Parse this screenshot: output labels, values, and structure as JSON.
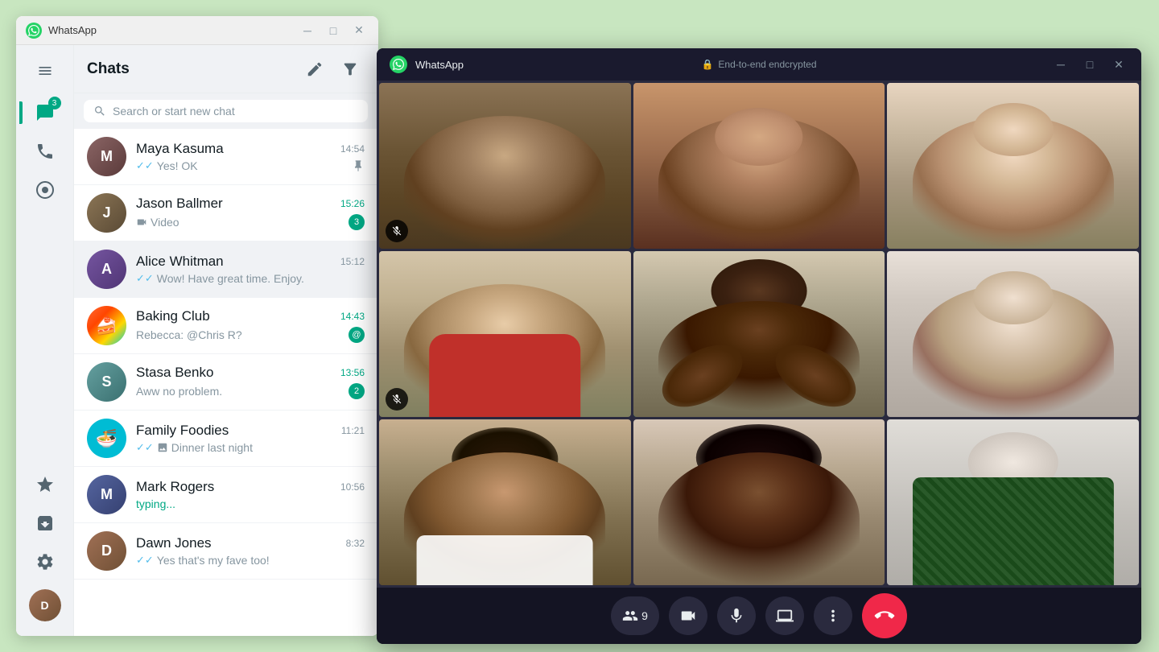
{
  "app": {
    "name": "WhatsApp",
    "titlebar": {
      "title": "WhatsApp"
    }
  },
  "sidebar": {
    "badge": "3",
    "items": [
      {
        "id": "chats",
        "label": "Chats",
        "icon": "chat",
        "active": true
      },
      {
        "id": "calls",
        "label": "Calls",
        "icon": "phone"
      },
      {
        "id": "status",
        "label": "Status",
        "icon": "status"
      },
      {
        "id": "starred",
        "label": "Starred",
        "icon": "star"
      },
      {
        "id": "archive",
        "label": "Archive",
        "icon": "archive"
      },
      {
        "id": "settings",
        "label": "Settings",
        "icon": "settings"
      }
    ]
  },
  "chat_panel": {
    "title": "Chats",
    "search_placeholder": "Search or start new chat",
    "chats": [
      {
        "id": "maya",
        "name": "Maya Kasuma",
        "preview": "Yes! OK",
        "time": "14:54",
        "unread": 0,
        "pinned": true,
        "read": true
      },
      {
        "id": "jason",
        "name": "Jason Ballmer",
        "preview": "Video",
        "time": "15:26",
        "unread": 3,
        "video": true,
        "read": false
      },
      {
        "id": "alice",
        "name": "Alice Whitman",
        "preview": "Wow! Have great time. Enjoy.",
        "time": "15:12",
        "unread": 0,
        "active": true,
        "read": true
      },
      {
        "id": "baking",
        "name": "Baking Club",
        "preview": "Rebecca: @Chris R?",
        "time": "14:43",
        "unread": 1,
        "mention": true
      },
      {
        "id": "stasa",
        "name": "Stasa Benko",
        "preview": "Aww no problem.",
        "time": "13:56",
        "unread": 2
      },
      {
        "id": "family",
        "name": "Family Foodies",
        "preview": "Dinner last night",
        "time": "11:21",
        "unread": 0,
        "read": true,
        "image": true
      },
      {
        "id": "mark",
        "name": "Mark Rogers",
        "preview": "typing...",
        "time": "10:56",
        "unread": 0,
        "typing": true
      },
      {
        "id": "dawn",
        "name": "Dawn Jones",
        "preview": "Yes that's my fave too!",
        "time": "8:32",
        "unread": 0,
        "read": true
      }
    ]
  },
  "video_call": {
    "titlebar": "WhatsApp",
    "encryption": "End-to-end endcrypted",
    "participants_count": "9",
    "participants": [
      {
        "id": "p1",
        "muted": true,
        "highlighted": false
      },
      {
        "id": "p2",
        "muted": false,
        "highlighted": false
      },
      {
        "id": "p3",
        "muted": false,
        "highlighted": false
      },
      {
        "id": "p4",
        "muted": true,
        "highlighted": false
      },
      {
        "id": "p5",
        "muted": false,
        "highlighted": true
      },
      {
        "id": "p6",
        "muted": false,
        "highlighted": false
      },
      {
        "id": "p7",
        "muted": false,
        "highlighted": false
      },
      {
        "id": "p8",
        "muted": false,
        "highlighted": false
      },
      {
        "id": "p9",
        "muted": false,
        "highlighted": false
      }
    ],
    "controls": {
      "participants_label": "9",
      "end_call_icon": "📞"
    }
  }
}
